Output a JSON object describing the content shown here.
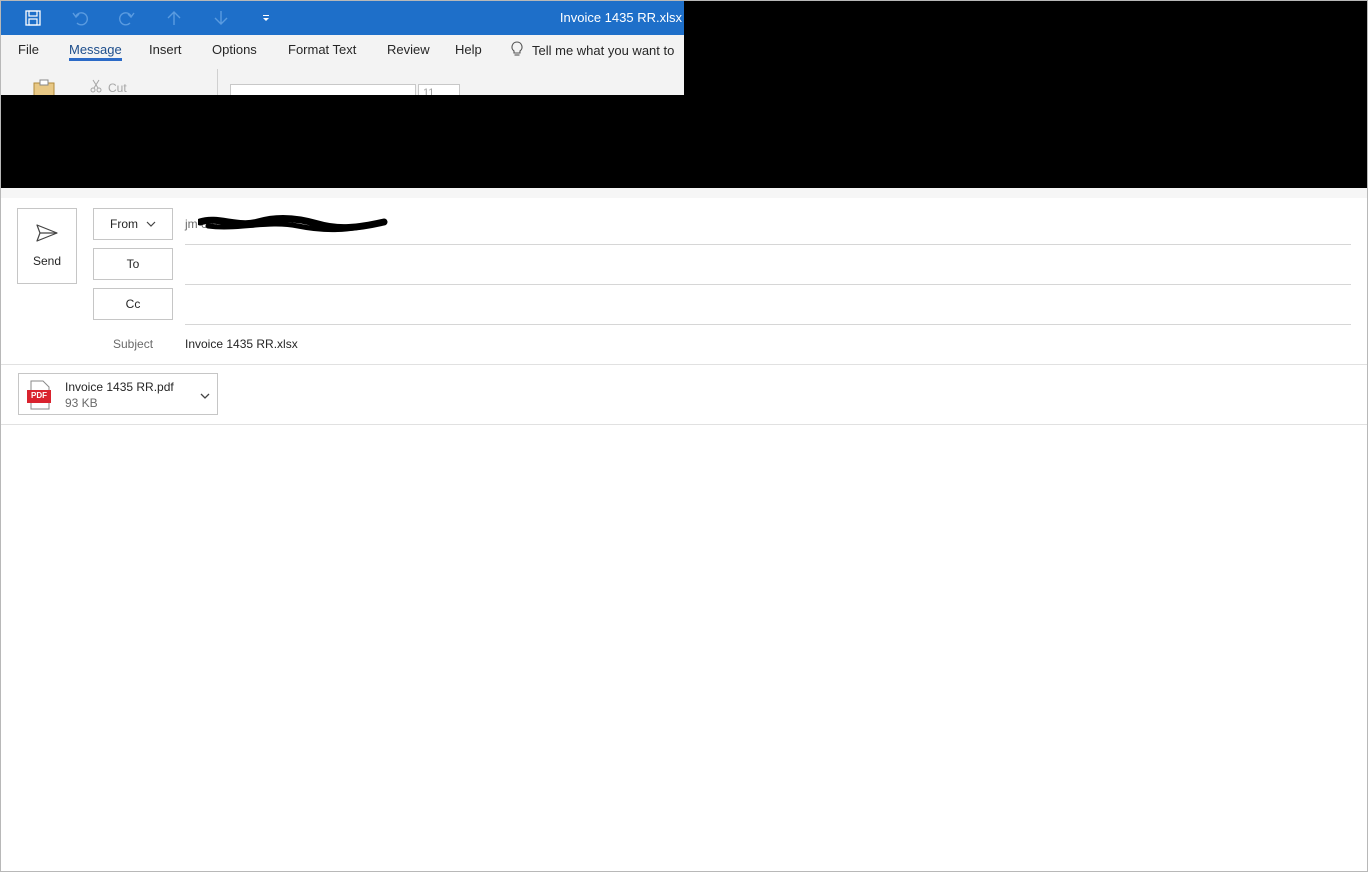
{
  "window": {
    "title": "Invoice 1435 RR.xlsx"
  },
  "quick_access": {
    "icons": [
      "save-icon",
      "undo-icon",
      "redo-icon",
      "up-arrow-icon",
      "down-arrow-icon",
      "customize-icon"
    ]
  },
  "ribbon": {
    "tabs": [
      {
        "label": "File"
      },
      {
        "label": "Message",
        "active": true
      },
      {
        "label": "Insert"
      },
      {
        "label": "Options"
      },
      {
        "label": "Format Text"
      },
      {
        "label": "Review"
      },
      {
        "label": "Help"
      }
    ],
    "tell_me": "Tell me what you want to",
    "cut_label": "Cut",
    "font_size": "11"
  },
  "compose": {
    "send_label": "Send",
    "from_label": "From",
    "from_value": "jm                                       om",
    "to_label": "To",
    "to_value": "",
    "cc_label": "Cc",
    "cc_value": "",
    "subject_label": "Subject",
    "subject_value": "Invoice 1435 RR.xlsx"
  },
  "attachment": {
    "type_badge": "PDF",
    "name": "Invoice 1435 RR.pdf",
    "size": "93 KB"
  },
  "colors": {
    "title_bar": "#1e6fc9",
    "accent": "#2b6ac7",
    "pdf_red": "#d9232e"
  }
}
